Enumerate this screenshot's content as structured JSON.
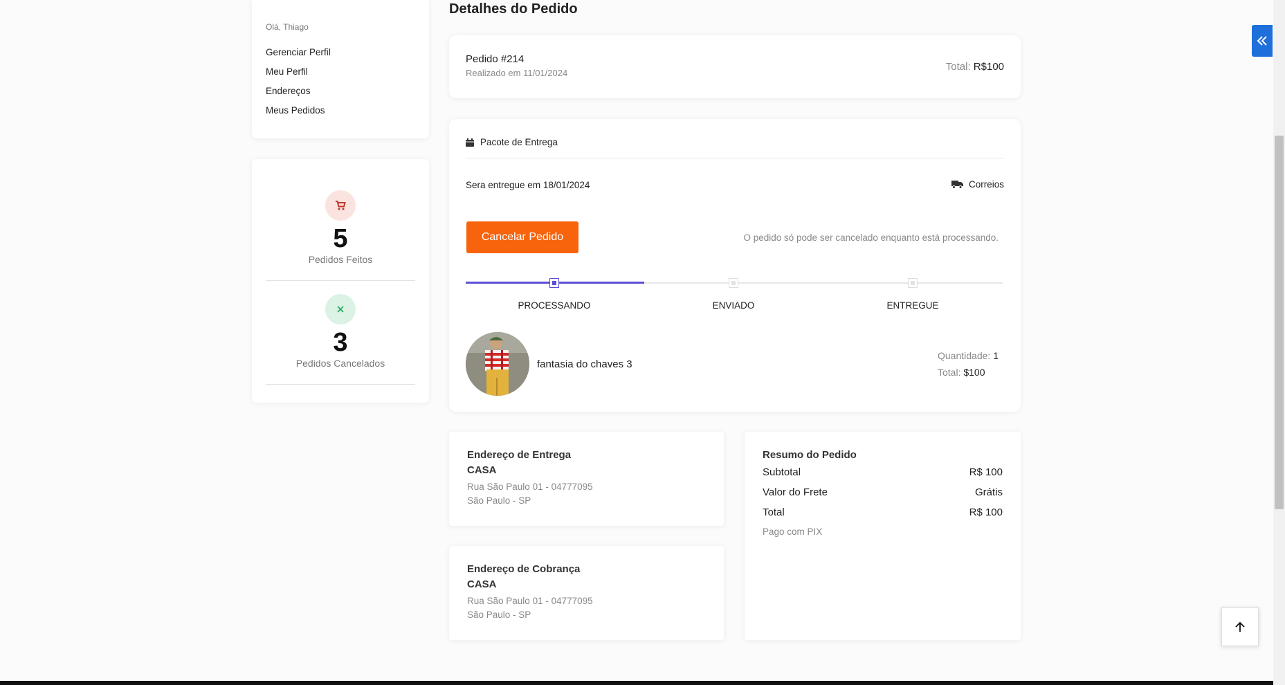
{
  "sidebar": {
    "greeting": "Olá, Thiago",
    "links": [
      "Gerenciar Perfil",
      "Meu Perfil",
      "Endereços",
      "Meus Pedidos"
    ]
  },
  "stats": [
    {
      "value": "5",
      "label": "Pedidos Feitos",
      "icon": "cart-icon",
      "icon_color": "#c0392b",
      "bg": "#fbe3df"
    },
    {
      "value": "3",
      "label": "Pedidos Cancelados",
      "icon": "close-icon",
      "icon_color": "#27ae60",
      "bg": "#dcf2e4"
    }
  ],
  "page_title": "Detalhes do Pedido",
  "order": {
    "number": "Pedido #214",
    "date": "Realizado em 11/01/2024",
    "total_label": "Total:",
    "total_value": "R$100"
  },
  "package": {
    "title": "Pacote de Entrega",
    "delivery": "Sera entregue em 18/01/2024",
    "carrier": "Correios",
    "cancel_button": "Cancelar Pedido",
    "cancel_note": "O pedido só pode ser cancelado enquanto está processando.",
    "steps": [
      "PROCESSANDO",
      "ENVIADO",
      "ENTREGUE"
    ],
    "active_step": 0,
    "item": {
      "name": "fantasia do chaves 3",
      "qty_label": "Quantidade:",
      "qty": "1",
      "total_label": "Total:",
      "total": "$100"
    }
  },
  "shipping": {
    "title": "Endereço de Entrega",
    "name": "CASA",
    "line1": "Rua São Paulo 01 - 04777095",
    "line2": "São Paulo - SP"
  },
  "billing": {
    "title": "Endereço de Cobrança",
    "name": "CASA",
    "line1": "Rua São Paulo 01 - 04777095",
    "line2": "São Paulo - SP"
  },
  "summary": {
    "title": "Resumo do Pedido",
    "rows": [
      {
        "label": "Subtotal",
        "value": "R$ 100"
      },
      {
        "label": "Valor do Frete",
        "value": "Grátis"
      },
      {
        "label": "Total",
        "value": "R$ 100"
      }
    ],
    "payment": "Pago com PIX"
  },
  "colors": {
    "accent": "#f7640c",
    "progress": "#5b4fd6",
    "toggle": "#1e6fd9"
  }
}
